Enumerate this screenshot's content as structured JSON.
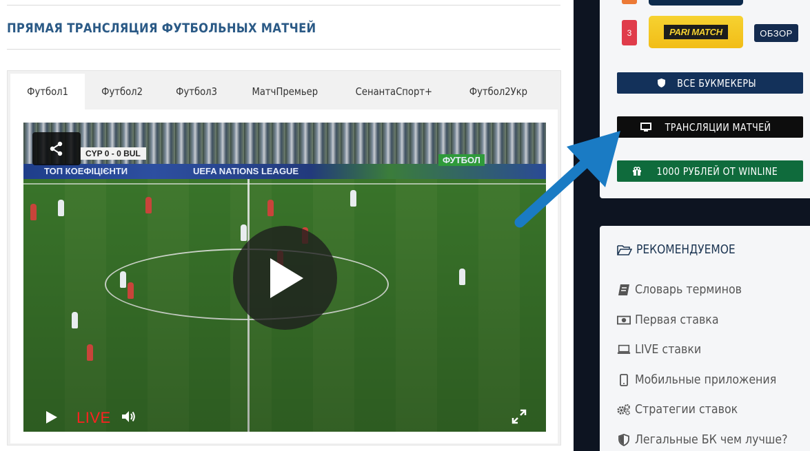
{
  "main": {
    "title": "ПРЯМАЯ ТРАНСЛЯЦИЯ ФУТБОЛЬНЫХ МАТЧЕЙ",
    "tabs": [
      {
        "label": "Футбол1",
        "active": true
      },
      {
        "label": "Футбол2",
        "active": false
      },
      {
        "label": "Футбол3",
        "active": false
      },
      {
        "label": "МатчПремьер",
        "active": false
      },
      {
        "label": "СенантаСпорт+",
        "active": false
      },
      {
        "label": "Футбол2Укр",
        "active": false
      }
    ],
    "video": {
      "score": "CYP 0 - 0 BUL",
      "board_left": "ТОП КОЕФІЦІЄНТИ",
      "board_center": "UEFA NATIONS LEAGUE",
      "board_right": "ФУТБОЛ",
      "live_label": "LIVE",
      "icons": [
        "share-icon",
        "play-icon",
        "volume-icon",
        "fullscreen-icon"
      ]
    }
  },
  "sidebar": {
    "rank": "3",
    "bookmaker_logo": "PARI MATCH",
    "review_label": "ОБЗОР",
    "buttons": {
      "all_bookmakers": "ВСЕ БУКМЕКЕРЫ",
      "streams": "ТРАНСЛЯЦИИ МАТЧЕЙ",
      "winline": "1000 РУБЛЕЙ ОТ WINLINE"
    },
    "recommended": {
      "title": "РЕКОМЕНДУЕМОЕ",
      "items": [
        {
          "label": "Словарь терминов",
          "icon": "book-icon"
        },
        {
          "label": "Первая ставка",
          "icon": "money-icon"
        },
        {
          "label": "LIVE ставки",
          "icon": "laptop-icon"
        },
        {
          "label": "Мобильные приложения",
          "icon": "mobile-icon"
        },
        {
          "label": "Стратегии ставок",
          "icon": "gears-icon"
        },
        {
          "label": "Легальные БК чем лучше?",
          "icon": "shield-icon"
        }
      ]
    }
  },
  "colors": {
    "title_blue": "#2b5a86",
    "btn_navy": "#13315a",
    "btn_black": "#0d0d0d",
    "btn_green": "#0f6b3c",
    "live_red": "#ff2020",
    "arrow_blue": "#1a7bc4"
  }
}
